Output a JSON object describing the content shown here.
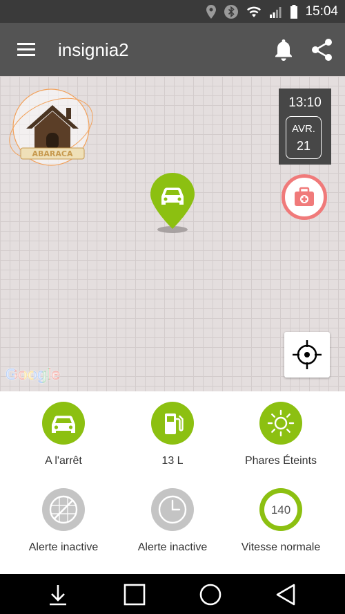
{
  "status_bar": {
    "time": "15:04",
    "icons": [
      "location-icon",
      "bluetooth-icon",
      "wifi-icon",
      "signal-icon",
      "battery-icon"
    ]
  },
  "app_bar": {
    "title": "insignia2",
    "icons": [
      "menu-icon",
      "bell-icon",
      "share-icon"
    ]
  },
  "map": {
    "time": "13:10",
    "date_month": "AVR.",
    "date_day": "21",
    "attribution": "Google",
    "logo_lettering": "ABARACA",
    "colors": {
      "pin": "#8cc011",
      "medkit": "#f07a7a",
      "datebox": "#474747"
    }
  },
  "status": {
    "items": [
      {
        "label": "A l'arrêt",
        "icon": "car-icon",
        "active": true
      },
      {
        "label": "13 L",
        "icon": "fuel-pump-icon",
        "active": true
      },
      {
        "label": "Phares Éteints",
        "icon": "sun-icon",
        "active": true
      },
      {
        "label": "Alerte inactive",
        "icon": "radar-icon",
        "active": false
      },
      {
        "label": "Alerte inactive",
        "icon": "clock-icon",
        "active": false
      },
      {
        "label": "Vitesse normale",
        "icon": "speed-icon",
        "active": true,
        "value": "140"
      }
    ],
    "colors": {
      "active": "#8cc011",
      "inactive": "#c4c4c4"
    }
  },
  "nav_bar": {
    "icons": [
      "hide-keyboard-icon",
      "recents-icon",
      "home-icon",
      "back-icon"
    ]
  }
}
